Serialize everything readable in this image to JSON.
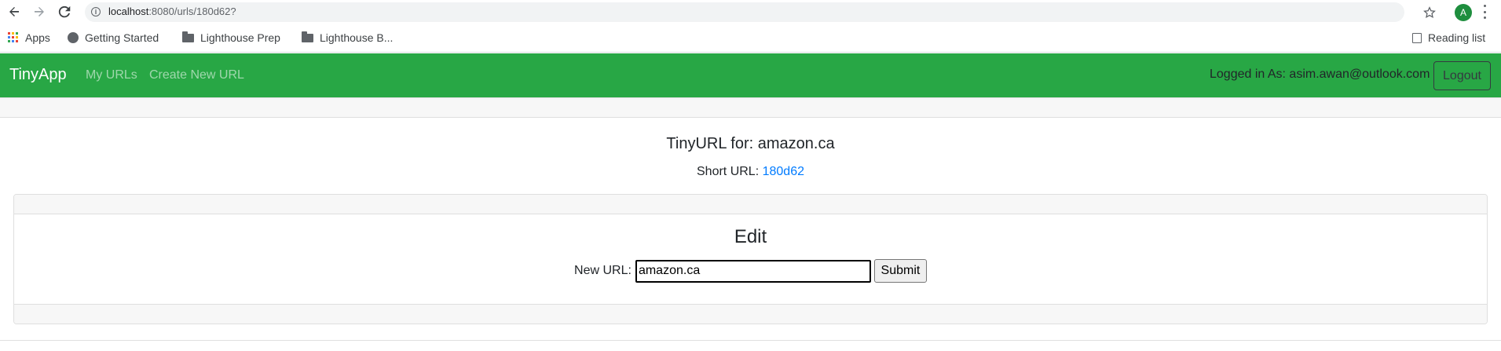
{
  "browser": {
    "url_host": "localhost",
    "url_path": ":8080/urls/180d62?",
    "profile_initial": "A",
    "bookmarks": [
      {
        "label": "Apps",
        "icon": "apps-grid-icon"
      },
      {
        "label": "Getting Started",
        "icon": "globe-icon"
      },
      {
        "label": "Lighthouse Prep",
        "icon": "folder-icon"
      },
      {
        "label": "Lighthouse B...",
        "icon": "folder-icon"
      }
    ],
    "reading_list": "Reading list"
  },
  "navbar": {
    "brand": "TinyApp",
    "links": [
      "My URLs",
      "Create New URL"
    ],
    "logged_in_text": "Logged in As: asim.awan@outlook.com",
    "logout_label": "Logout",
    "color": "#28a745"
  },
  "main": {
    "title": "TinyURL for: amazon.ca",
    "short_url_label": "Short URL: ",
    "short_url_value": "180d62",
    "link_color": "#007bff"
  },
  "edit": {
    "title": "Edit",
    "new_url_label": "New URL:",
    "input_value": "amazon.ca",
    "submit_label": "Submit"
  }
}
